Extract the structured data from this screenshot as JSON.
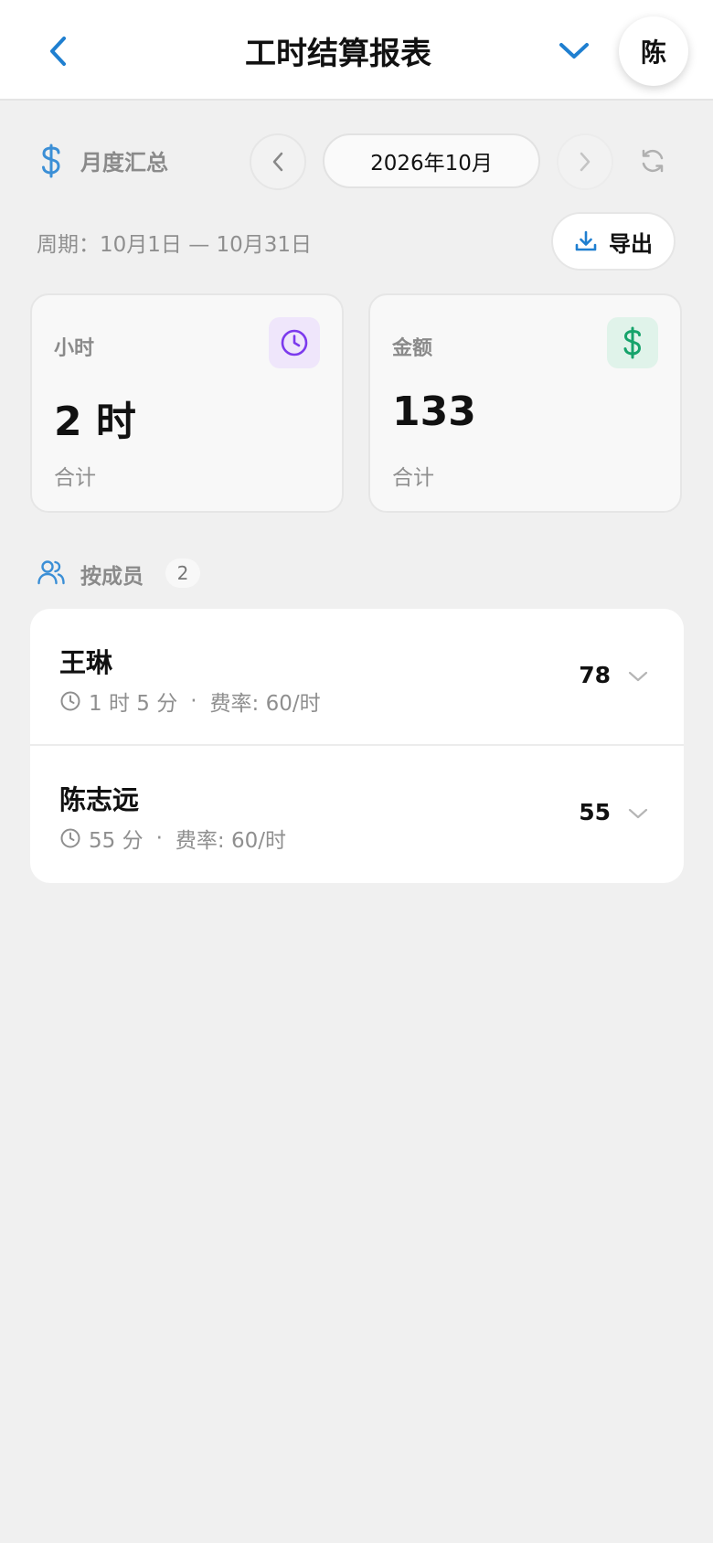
{
  "header": {
    "title": "工时结算报表",
    "avatar_initial": "陈",
    "accent_color": "#1f7fd0"
  },
  "summary": {
    "label": "月度汇总",
    "month": "2026年10月",
    "period": "周期：10月1日 — 10月31日",
    "export_label": "导出"
  },
  "cards": {
    "hours": {
      "label": "小时",
      "value": "2 时",
      "sub": "合计",
      "icon": "clock-icon",
      "icon_color": "#7c3aed"
    },
    "amount": {
      "label": "金额",
      "value": "133",
      "sub": "合计",
      "icon": "dollar-icon",
      "icon_color": "#16a36b"
    }
  },
  "members": {
    "label": "按成员",
    "count": "2",
    "items": [
      {
        "name": "王琳",
        "duration": "1 时 5 分",
        "rate": "费率: 60/时",
        "amount": "78"
      },
      {
        "name": "陈志远",
        "duration": "55 分",
        "rate": "费率: 60/时",
        "amount": "55"
      }
    ]
  }
}
